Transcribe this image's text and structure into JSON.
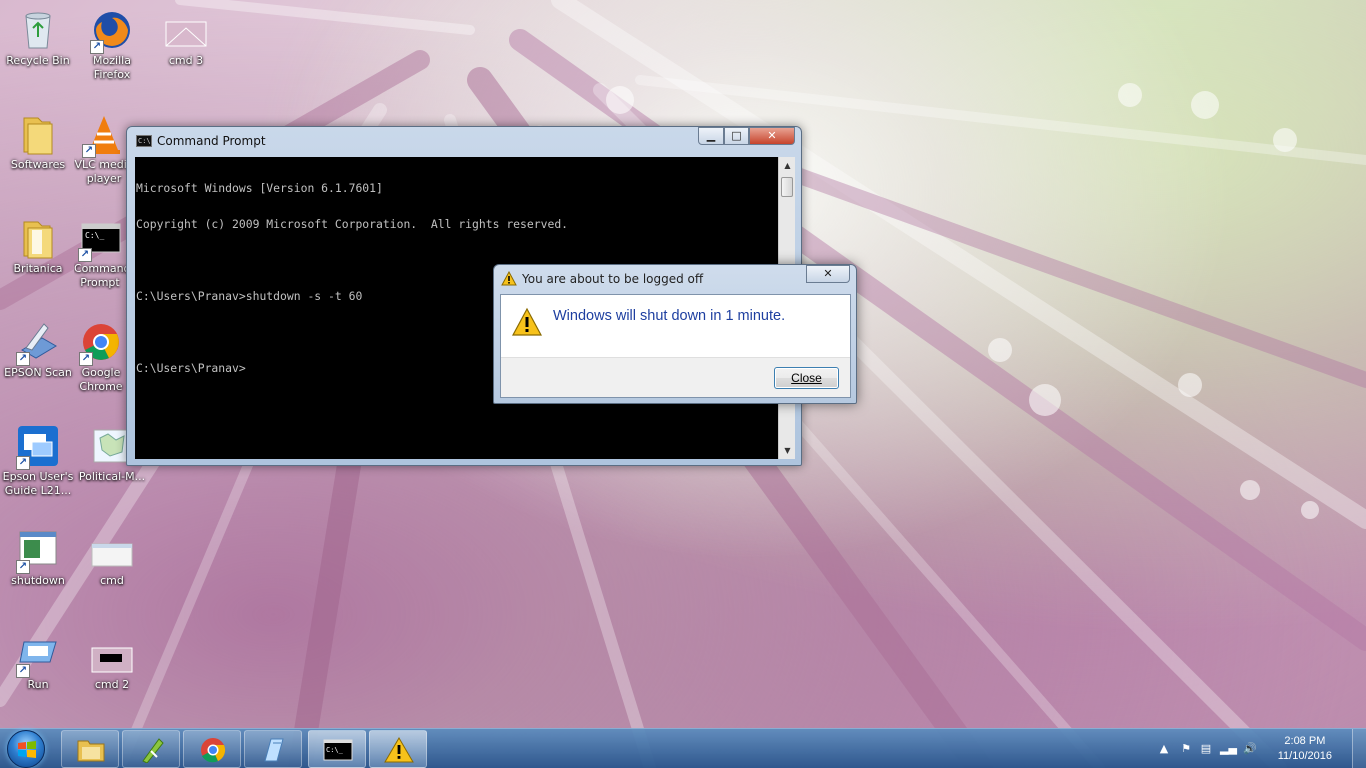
{
  "desktop": {
    "icons": [
      {
        "label": "Recycle Bin",
        "icon": "recycle-bin-icon"
      },
      {
        "label": "Mozilla Firefox",
        "icon": "firefox-icon"
      },
      {
        "label": "cmd 3",
        "icon": "image-file-icon"
      },
      {
        "label": "Softwares",
        "icon": "folder-icon"
      },
      {
        "label": "VLC media player",
        "icon": "vlc-icon"
      },
      {
        "label": "Britanica",
        "icon": "folder-icon"
      },
      {
        "label": "Command Prompt",
        "icon": "cmd-icon"
      },
      {
        "label": "EPSON Scan",
        "icon": "scanner-icon"
      },
      {
        "label": "Google Chrome",
        "icon": "chrome-icon"
      },
      {
        "label": "Epson User's Guide L21...",
        "icon": "epson-guide-icon"
      },
      {
        "label": "Political-M...",
        "icon": "map-image-icon"
      },
      {
        "label": "shutdown",
        "icon": "shutdown-shortcut-icon"
      },
      {
        "label": "cmd",
        "icon": "image-file-icon"
      },
      {
        "label": "Run",
        "icon": "run-icon"
      },
      {
        "label": "cmd 2",
        "icon": "image-file-icon"
      }
    ]
  },
  "cmd_window": {
    "title": "Command Prompt",
    "lines": [
      "Microsoft Windows [Version 6.1.7601]",
      "Copyright (c) 2009 Microsoft Corporation.  All rights reserved.",
      "",
      "C:\\Users\\Pranav>shutdown -s -t 60",
      "",
      "C:\\Users\\Pranav>"
    ],
    "min_label": "▁",
    "max_label": "□",
    "close_label": "✕"
  },
  "dialog": {
    "title": "You are about to be logged off",
    "message": "Windows will shut down in 1 minute.",
    "close_button": "Close",
    "close_x": "✕"
  },
  "taskbar": {
    "pinned": [
      {
        "name": "explorer",
        "icon": "folder-library-icon"
      },
      {
        "name": "corel",
        "icon": "corel-icon"
      },
      {
        "name": "chrome",
        "icon": "chrome-icon"
      },
      {
        "name": "paint",
        "icon": "paint-icon"
      },
      {
        "name": "cmd",
        "icon": "cmd-icon"
      },
      {
        "name": "warning",
        "icon": "warning-icon"
      }
    ],
    "clock_time": "2:08 PM",
    "clock_date": "11/10/2016"
  }
}
